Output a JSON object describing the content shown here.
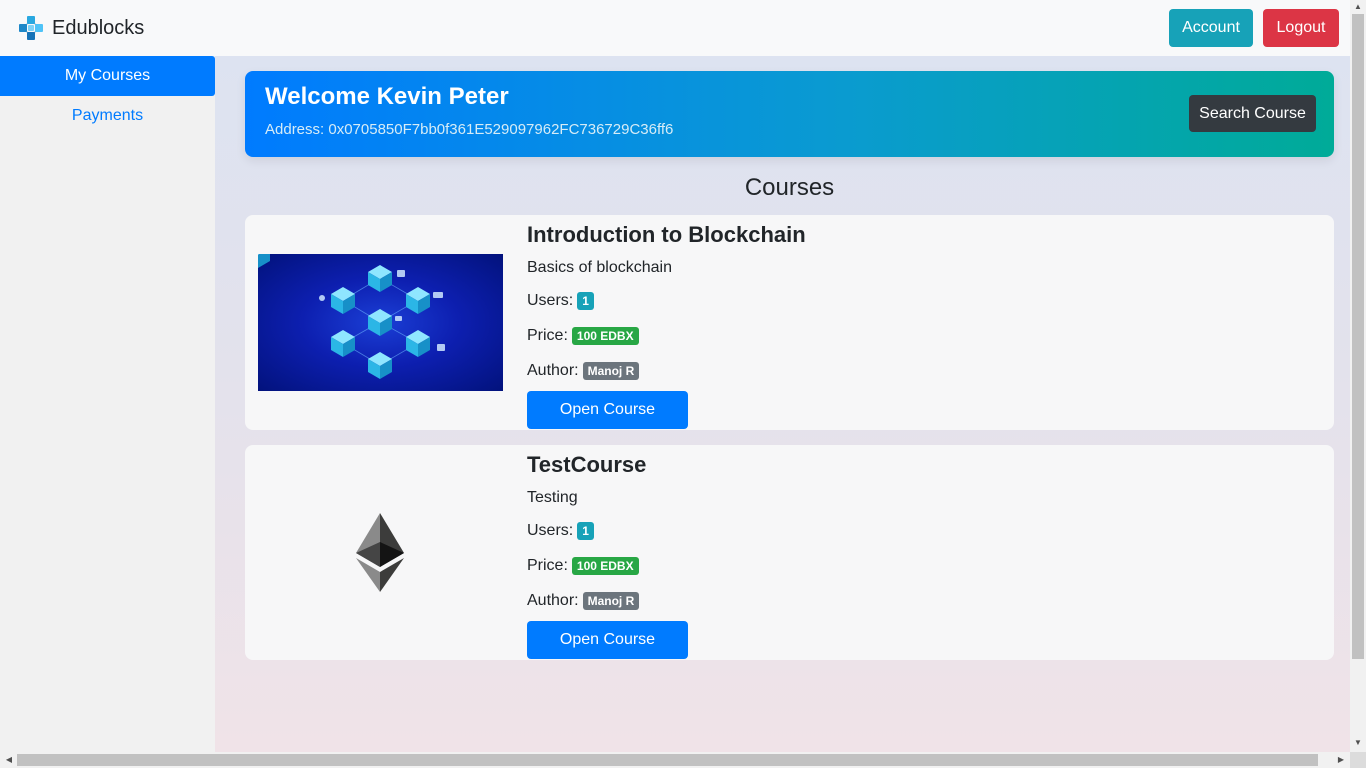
{
  "navbar": {
    "brand": "Edublocks",
    "account_label": "Account",
    "logout_label": "Logout"
  },
  "sidebar": {
    "items": [
      {
        "label": "My Courses",
        "active": true
      },
      {
        "label": "Payments",
        "active": false
      }
    ]
  },
  "welcome": {
    "title": "Welcome Kevin Peter",
    "address": "Address: 0x0705850F7bb0f361E529097962FC736729C36ff6",
    "search_label": "Search Course"
  },
  "courses_heading": "Courses",
  "courses": [
    {
      "title": "Introduction to Blockchain",
      "description": "Basics of blockchain",
      "users_label": "Users:",
      "users": "1",
      "price_label": "Price:",
      "price": "100 EDBX",
      "author_label": "Author:",
      "author": "Manoj R",
      "open_label": "Open Course",
      "thumbnail": "blockchain-cubes-image"
    },
    {
      "title": "TestCourse",
      "description": "Testing",
      "users_label": "Users:",
      "users": "1",
      "price_label": "Price:",
      "price": "100 EDBX",
      "author_label": "Author:",
      "author": "Manoj R",
      "open_label": "Open Course",
      "thumbnail": "ethereum-logo-image"
    }
  ],
  "colors": {
    "primary": "#007bff",
    "info": "#17a2b8",
    "danger": "#dc3545",
    "success": "#28a745",
    "secondary": "#6c757d",
    "dark": "#343a40",
    "banner_end": "#00ab98"
  },
  "icons": {
    "brand": "edublocks-logo-icon"
  }
}
